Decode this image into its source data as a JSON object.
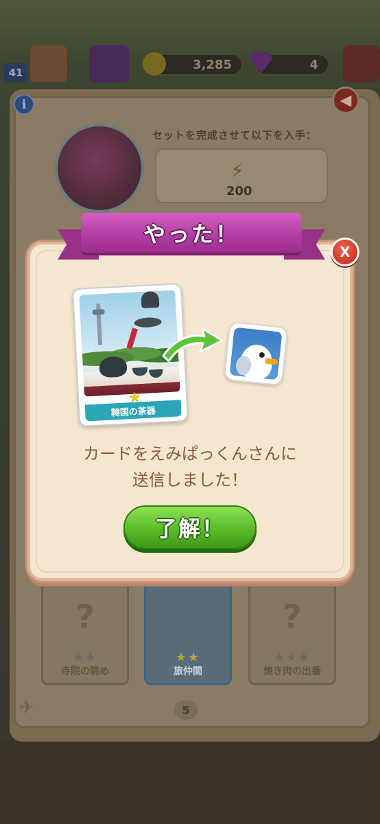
{
  "hud": {
    "level": "41",
    "coins": "3,285",
    "gems": "4"
  },
  "album": {
    "set_reward_header": "セットを完成させて以下を入手：",
    "reward_value": "200",
    "cards": [
      {
        "name": "寺院の眺め",
        "stars": "★★"
      },
      {
        "name": "旅仲間",
        "stars": "★★"
      },
      {
        "name": "焼き肉の出番",
        "stars": "★★★"
      }
    ],
    "page_number": "5"
  },
  "dialog": {
    "title": "やった！",
    "close_label": "X",
    "card_name": "韓国の茶器",
    "card_star": "★",
    "message_line1": "カードをえみぱっくんさんに",
    "message_line2": "送信しました！",
    "ok_label": "了解！"
  },
  "colors": {
    "ribbon": "#b33fa4",
    "ok_button": "#5cbf2a",
    "close_button": "#c4261c",
    "dialog_bg": "#f5e6d0",
    "card_label": "#2aa6b8"
  },
  "icons": {
    "coin": "coin-icon",
    "gem": "gem-icon",
    "info": "info-icon",
    "back": "back-arrow-icon",
    "energy": "lightning-icon",
    "plane": "plane-icon",
    "arrow": "send-arrow-icon"
  }
}
